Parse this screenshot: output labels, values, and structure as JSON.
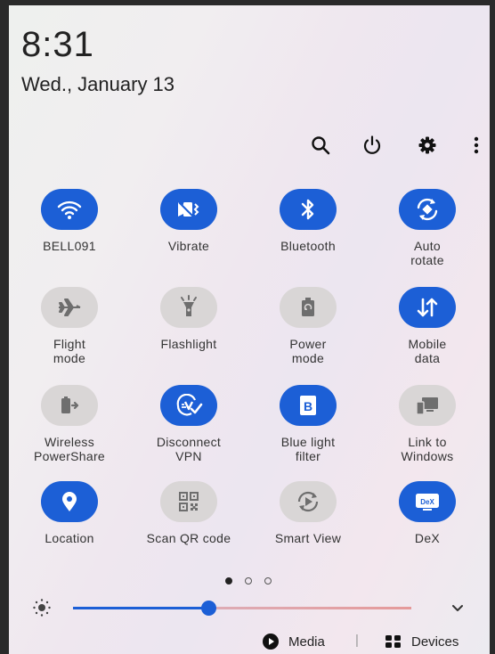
{
  "status": {
    "time": "8:31",
    "date": "Wed., January 13"
  },
  "toolbar": {
    "icons": [
      "search-icon",
      "power-icon",
      "gear-icon",
      "more-vertical-icon"
    ]
  },
  "tiles": [
    {
      "label": "BELL091",
      "icon": "wifi-icon",
      "state": "on"
    },
    {
      "label": "Vibrate",
      "icon": "vibrate-icon",
      "state": "on"
    },
    {
      "label": "Bluetooth",
      "icon": "bluetooth-icon",
      "state": "on"
    },
    {
      "label": "Auto\nrotate",
      "icon": "auto-rotate-icon",
      "state": "on"
    },
    {
      "label": "Flight\nmode",
      "icon": "airplane-icon",
      "state": "off"
    },
    {
      "label": "Flashlight",
      "icon": "flashlight-icon",
      "state": "off"
    },
    {
      "label": "Power\nmode",
      "icon": "power-mode-icon",
      "state": "off"
    },
    {
      "label": "Mobile\ndata",
      "icon": "mobile-data-icon",
      "state": "on"
    },
    {
      "label": "Wireless\nPowerShare",
      "icon": "wireless-powershare-icon",
      "state": "off"
    },
    {
      "label": "Disconnect\nVPN",
      "icon": "vpn-icon",
      "state": "on"
    },
    {
      "label": "Blue light\nfilter",
      "icon": "blue-light-filter-icon",
      "state": "on"
    },
    {
      "label": "Link to\nWindows",
      "icon": "link-to-windows-icon",
      "state": "off"
    },
    {
      "label": "Location",
      "icon": "location-icon",
      "state": "on"
    },
    {
      "label": "Scan QR code",
      "icon": "qr-code-icon",
      "state": "off"
    },
    {
      "label": "Smart View",
      "icon": "smart-view-icon",
      "state": "off"
    },
    {
      "label": "DeX",
      "icon": "dex-icon",
      "state": "on"
    }
  ],
  "pager": {
    "pages": 3,
    "current": 1
  },
  "brightness": {
    "level": 0.4
  },
  "bottom": {
    "media_label": "Media",
    "separator": "|",
    "devices_label": "Devices"
  },
  "colors": {
    "accent": "#1c5fd6",
    "tile_off": "#d9d6d6",
    "icon_off": "#6e6e6e"
  }
}
